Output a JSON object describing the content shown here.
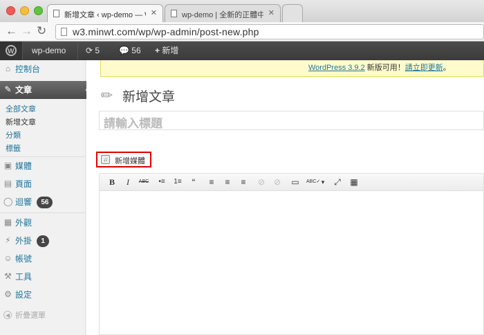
{
  "browser": {
    "tabs": [
      {
        "title": "新增文章 ‹ wp-demo — Wo",
        "active": true
      },
      {
        "title": "wp-demo | 全新的正體中文",
        "active": false
      }
    ],
    "url": "w3.minwt.com/wp/wp-admin/post-new.php"
  },
  "adminbar": {
    "site_name": "wp-demo",
    "updates_count": "5",
    "comments_count": "56",
    "new_label": "新增"
  },
  "sidebar": {
    "dashboard": "控制台",
    "posts": "文章",
    "posts_submenu": [
      "全部文章",
      "新增文章",
      "分類",
      "標籤"
    ],
    "media": "媒體",
    "pages": "頁面",
    "comments": "迴響",
    "comments_badge": "56",
    "appearance": "外觀",
    "plugins": "外掛",
    "plugins_badge": "1",
    "users": "帳號",
    "tools": "工具",
    "settings": "設定",
    "collapse": "折疊選單"
  },
  "main": {
    "notice_version": "WordPress 3.9.2",
    "notice_text": " 新版可用！",
    "notice_link": "請立即更新",
    "notice_end": "。",
    "page_title": "新增文章",
    "title_placeholder": "請輸入標題",
    "add_media": "新增媒體"
  },
  "editor_toolbar": [
    "B",
    "I",
    "ABC",
    "•≡",
    "1≡",
    "“",
    "≡",
    "≡",
    "≡",
    "⊘",
    "⊘",
    "▭",
    "ABC✓",
    "▾",
    "⤢",
    "▦"
  ]
}
